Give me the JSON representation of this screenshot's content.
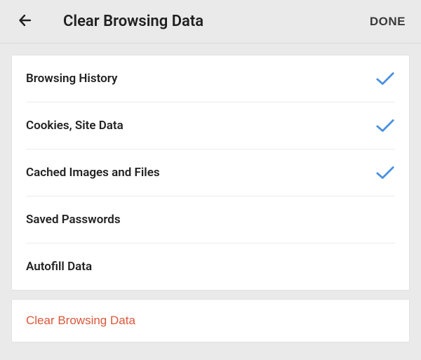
{
  "header": {
    "title": "Clear Browsing Data",
    "done_label": "DONE"
  },
  "colors": {
    "check": "#4a90e2",
    "action": "#d95738"
  },
  "items": [
    {
      "label": "Browsing History",
      "checked": true
    },
    {
      "label": "Cookies, Site Data",
      "checked": true
    },
    {
      "label": "Cached Images and Files",
      "checked": true
    },
    {
      "label": "Saved Passwords",
      "checked": false
    },
    {
      "label": "Autofill Data",
      "checked": false
    }
  ],
  "action": {
    "label": "Clear Browsing Data"
  }
}
